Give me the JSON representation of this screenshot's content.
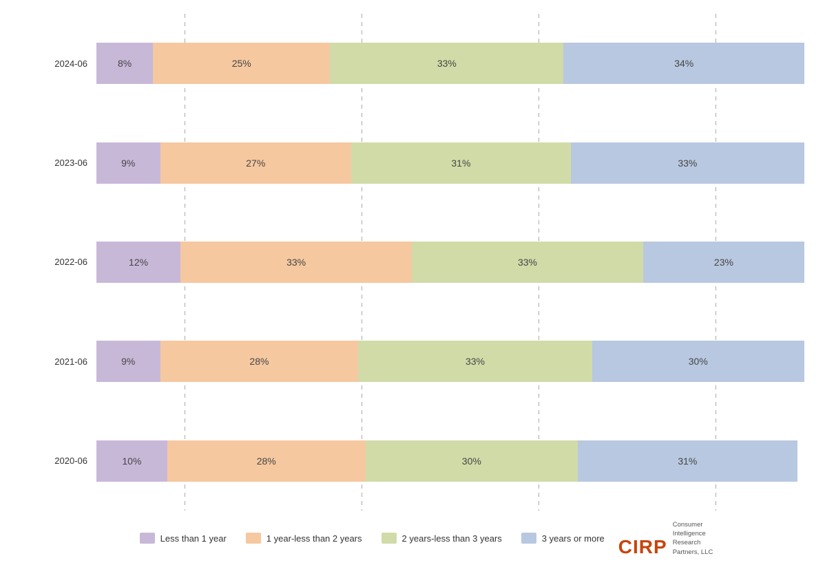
{
  "chart": {
    "rows": [
      {
        "label": "2024-06",
        "segments": [
          {
            "pct": 8,
            "class": "seg-purple",
            "label": "8%"
          },
          {
            "pct": 25,
            "class": "seg-orange",
            "label": "25%"
          },
          {
            "pct": 33,
            "class": "seg-green",
            "label": "33%"
          },
          {
            "pct": 34,
            "class": "seg-blue",
            "label": "34%"
          }
        ]
      },
      {
        "label": "2023-06",
        "segments": [
          {
            "pct": 9,
            "class": "seg-purple",
            "label": "9%"
          },
          {
            "pct": 27,
            "class": "seg-orange",
            "label": "27%"
          },
          {
            "pct": 31,
            "class": "seg-green",
            "label": "31%"
          },
          {
            "pct": 33,
            "class": "seg-blue",
            "label": "33%"
          }
        ]
      },
      {
        "label": "2022-06",
        "segments": [
          {
            "pct": 12,
            "class": "seg-purple",
            "label": "12%"
          },
          {
            "pct": 33,
            "class": "seg-orange",
            "label": "33%"
          },
          {
            "pct": 33,
            "class": "seg-green",
            "label": "33%"
          },
          {
            "pct": 23,
            "class": "seg-blue",
            "label": "23%"
          }
        ]
      },
      {
        "label": "2021-06",
        "segments": [
          {
            "pct": 9,
            "class": "seg-purple",
            "label": "9%"
          },
          {
            "pct": 28,
            "class": "seg-orange",
            "label": "28%"
          },
          {
            "pct": 33,
            "class": "seg-green",
            "label": "33%"
          },
          {
            "pct": 30,
            "class": "seg-blue",
            "label": "30%"
          }
        ]
      },
      {
        "label": "2020-06",
        "segments": [
          {
            "pct": 10,
            "class": "seg-purple",
            "label": "10%"
          },
          {
            "pct": 28,
            "class": "seg-orange",
            "label": "28%"
          },
          {
            "pct": 30,
            "class": "seg-green",
            "label": "30%"
          },
          {
            "pct": 31,
            "class": "seg-blue",
            "label": "31%"
          }
        ]
      }
    ],
    "legend": [
      {
        "label": "Less than 1 year",
        "class": "seg-purple"
      },
      {
        "label": "1 year-less than 2 years",
        "class": "seg-orange"
      },
      {
        "label": "2 years-less than 3 years",
        "class": "seg-green"
      },
      {
        "label": "3 years or more",
        "class": "seg-blue"
      }
    ],
    "cirp": {
      "brand": "CIRP",
      "subtitle": "Consumer\nIntelligence\nResearch\nPartners, LLC"
    }
  }
}
